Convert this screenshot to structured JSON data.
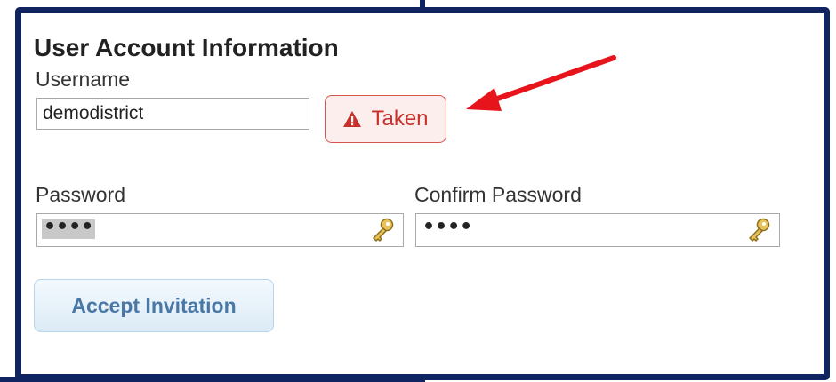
{
  "section": {
    "title": "User Account Information"
  },
  "username": {
    "label": "Username",
    "value": "demodistrict",
    "status_label": "Taken",
    "status_icon": "warning-triangle-icon",
    "status_color": "#c9302c"
  },
  "password": {
    "label": "Password",
    "masked_value": "••••",
    "icon": "key-icon"
  },
  "confirm_password": {
    "label": "Confirm Password",
    "masked_value": "••••",
    "icon": "key-icon"
  },
  "actions": {
    "accept_label": "Accept Invitation"
  },
  "annotation": {
    "arrow_color": "#e8141c",
    "frame_color": "#0f2460"
  }
}
